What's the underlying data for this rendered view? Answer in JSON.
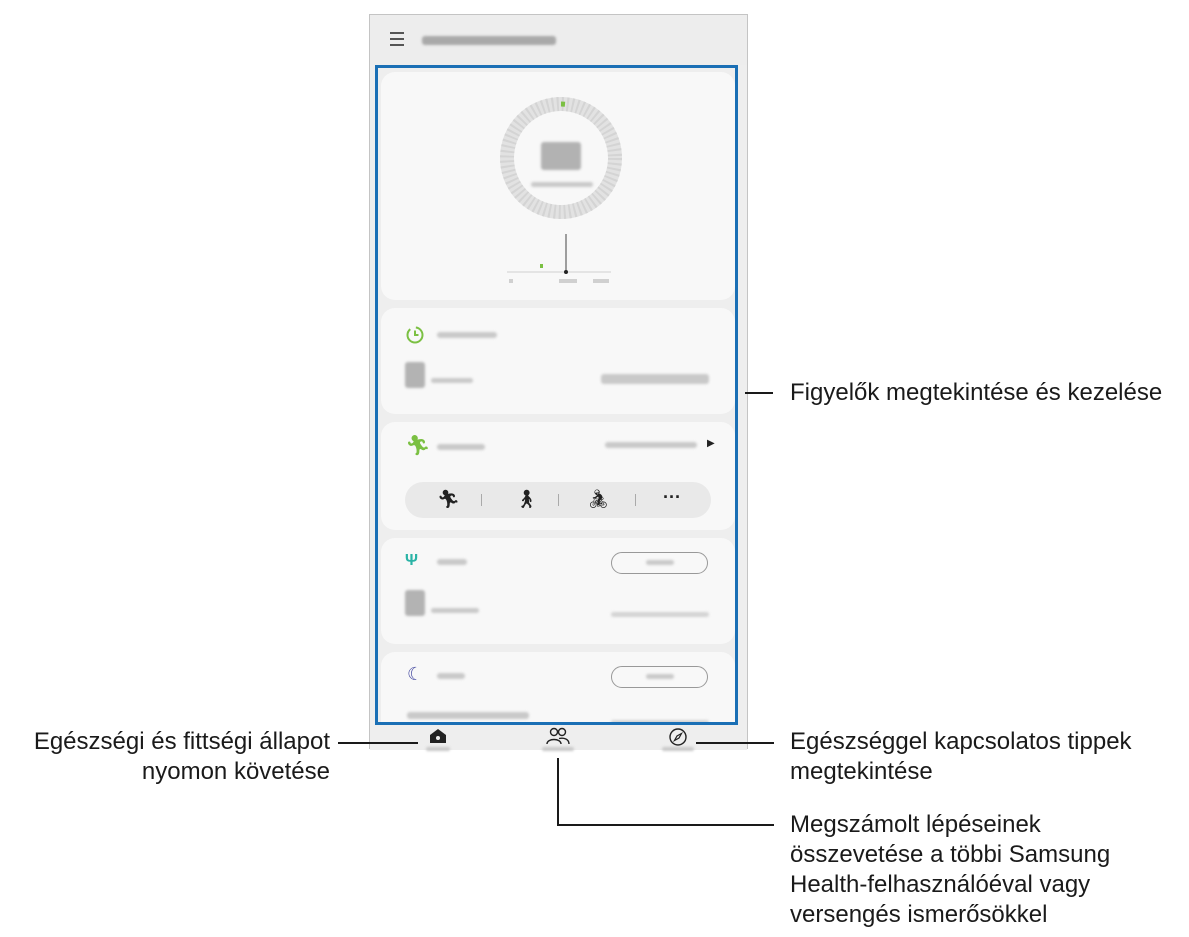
{
  "annotations": {
    "trackers": "Figyelők megtekintése és kezelése",
    "home_line1": "Egészségi és fittségi állapot",
    "home_line2": "nyomon követése",
    "discover_line1": "Egészséggel kapcsolatos tippek",
    "discover_line2": "megtekintése",
    "together_line1": "Megszámolt lépéseinek",
    "together_line2": "összevetése a többi Samsung",
    "together_line3": "Health-felhasználóéval vagy",
    "together_line4": "versengés ismerősökkel"
  },
  "colors": {
    "highlight": "#1a6fb5",
    "steps_green": "#7bc043",
    "sleep_purple": "#4a4fa3",
    "food_teal": "#2ab3a6"
  },
  "icons": {
    "menu": "hamburger-icon",
    "active_time": "clock-icon",
    "exercise": "running-icon",
    "food": "fork-knife-icon",
    "sleep": "moon-icon",
    "home": "home-icon",
    "together": "people-icon",
    "discover": "compass-icon"
  }
}
